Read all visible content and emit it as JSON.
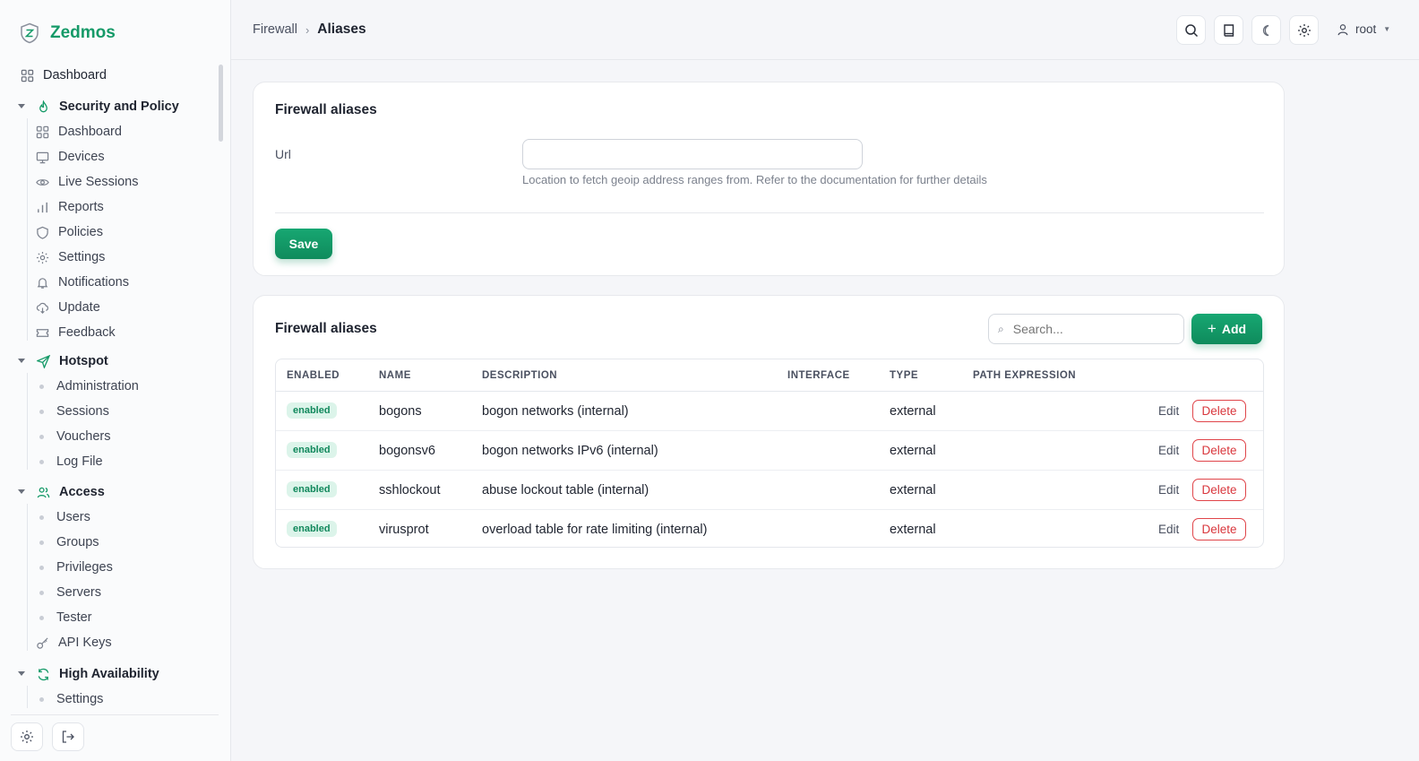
{
  "brand": {
    "name": "Zedmos"
  },
  "sidebar": {
    "dashboard": "Dashboard",
    "groups": [
      {
        "label": "Security and Policy",
        "icon": "flame-icon",
        "items": [
          {
            "label": "Dashboard",
            "icon": "grid-icon"
          },
          {
            "label": "Devices",
            "icon": "monitor-icon"
          },
          {
            "label": "Live Sessions",
            "icon": "eye-icon"
          },
          {
            "label": "Reports",
            "icon": "bar-chart-icon"
          },
          {
            "label": "Policies",
            "icon": "shield-icon"
          },
          {
            "label": "Settings",
            "icon": "gear-icon"
          },
          {
            "label": "Notifications",
            "icon": "bell-icon"
          },
          {
            "label": "Update",
            "icon": "cloud-download-icon"
          },
          {
            "label": "Feedback",
            "icon": "ticket-icon"
          }
        ]
      },
      {
        "label": "Hotspot",
        "icon": "send-icon",
        "items": [
          {
            "label": "Administration"
          },
          {
            "label": "Sessions"
          },
          {
            "label": "Vouchers"
          },
          {
            "label": "Log File"
          }
        ]
      },
      {
        "label": "Access",
        "icon": "users-icon",
        "items": [
          {
            "label": "Users"
          },
          {
            "label": "Groups"
          },
          {
            "label": "Privileges"
          },
          {
            "label": "Servers"
          },
          {
            "label": "Tester"
          },
          {
            "label": "API Keys",
            "icon": "key-icon"
          }
        ]
      },
      {
        "label": "High Availability",
        "icon": "refresh-icon",
        "items": [
          {
            "label": "Settings"
          }
        ]
      }
    ]
  },
  "topbar": {
    "breadcrumb": {
      "parent": "Firewall",
      "current": "Aliases"
    },
    "user": "root",
    "accent": "#159a68"
  },
  "form_card": {
    "title": "Firewall aliases",
    "url_label": "Url",
    "url_value": "",
    "help": "Location to fetch geoip address ranges from. Refer to the documentation for further details",
    "save_label": "Save"
  },
  "list_card": {
    "title": "Firewall aliases",
    "search_placeholder": "Search...",
    "add_label": "Add",
    "columns": [
      "ENABLED",
      "NAME",
      "DESCRIPTION",
      "INTERFACE",
      "TYPE",
      "PATH EXPRESSION"
    ],
    "rows": [
      {
        "enabled": "enabled",
        "name": "bogons",
        "description": "bogon networks (internal)",
        "interface": "",
        "type": "external",
        "path": ""
      },
      {
        "enabled": "enabled",
        "name": "bogonsv6",
        "description": "bogon networks IPv6 (internal)",
        "interface": "",
        "type": "external",
        "path": ""
      },
      {
        "enabled": "enabled",
        "name": "sshlockout",
        "description": "abuse lockout table (internal)",
        "interface": "",
        "type": "external",
        "path": ""
      },
      {
        "enabled": "enabled",
        "name": "virusprot",
        "description": "overload table for rate limiting (internal)",
        "interface": "",
        "type": "external",
        "path": ""
      }
    ],
    "edit_label": "Edit",
    "delete_label": "Delete"
  }
}
